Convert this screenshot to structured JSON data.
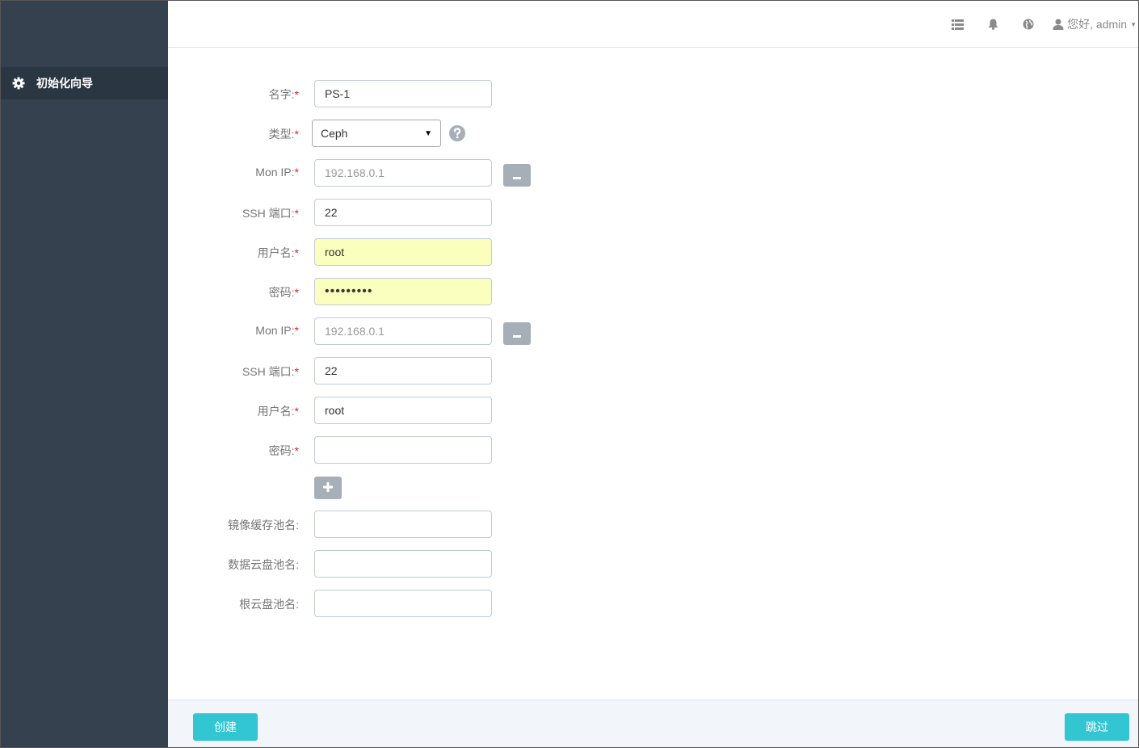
{
  "sidebar": {
    "items": [
      {
        "label": "初始化向导",
        "icon": "gear-icon"
      }
    ]
  },
  "topbar": {
    "icons": [
      "list-icon",
      "bell-icon",
      "globe-icon"
    ],
    "user_greeting": "您好, admin"
  },
  "form": {
    "name": {
      "label": "名字:",
      "value": "PS-1"
    },
    "type": {
      "label": "类型:",
      "selected": "Ceph"
    },
    "mon1": {
      "ip": {
        "label": "Mon IP:",
        "placeholder": "192.168.0.1"
      },
      "ssh_port": {
        "label": "SSH 端口:",
        "value": "22"
      },
      "username": {
        "label": "用户名:",
        "value": "root"
      },
      "password": {
        "label": "密码:",
        "value": "•••••••••"
      }
    },
    "mon2": {
      "ip": {
        "label": "Mon IP:",
        "placeholder": "192.168.0.1"
      },
      "ssh_port": {
        "label": "SSH 端口:",
        "value": "22"
      },
      "username": {
        "label": "用户名:",
        "value": "root"
      },
      "password": {
        "label": "密码:",
        "value": ""
      }
    },
    "image_cache_pool": {
      "label": "镜像缓存池名:"
    },
    "data_volume_pool": {
      "label": "数据云盘池名:"
    },
    "root_volume_pool": {
      "label": "根云盘池名:"
    },
    "required_mark": "*"
  },
  "footer": {
    "create_label": "创建",
    "skip_label": "跳过"
  },
  "colors": {
    "sidebar_bg": "#364150",
    "sidebar_active_bg": "#2b3643",
    "accent": "#32c5d2",
    "autofill_bg": "#faffbd",
    "required": "#e02222"
  }
}
